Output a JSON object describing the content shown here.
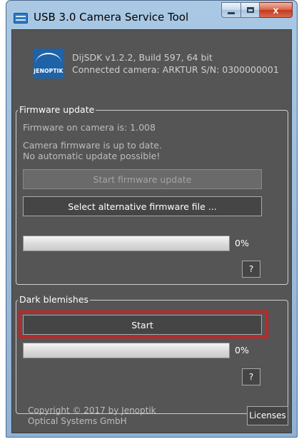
{
  "window": {
    "title": "USB 3.0 Camera Service Tool",
    "close_glyph": "x"
  },
  "logo": {
    "text": "JENOPTIK"
  },
  "sdk_info": {
    "version_line": "DijSDK v1.2.2, Build 597, 64 bit",
    "camera_line": "Connected camera: ARKTUR S/N: 0300000001"
  },
  "firmware_update": {
    "group_title": "Firmware update",
    "firmware_version": "Firmware on camera is: 1.008",
    "status_line1": "Camera firmware is up to date.",
    "status_line2": "No automatic update possible!",
    "start_button_label": "Start firmware update",
    "select_file_button_label": "Select alternative firmware file ...",
    "progress_label": "0%",
    "progress_value": 0,
    "help_button_label": "?"
  },
  "dark_blemishes": {
    "group_title": "Dark blemishes",
    "start_button_label": "Start",
    "progress_label": "0%",
    "progress_value": 0,
    "help_button_label": "?"
  },
  "footer": {
    "copyright_line1": "Copyright © 2017 by Jenoptik",
    "copyright_line2": "Optical Systems GmbH",
    "licenses_button_label": "Licenses"
  },
  "colors": {
    "panel_background": "#555555",
    "highlight_border": "#d11e1e",
    "logo_blue": "#1e62a8"
  },
  "icons": {
    "app": "camera-service-tool-icon",
    "minimize": "minimize-icon",
    "maximize": "maximize-icon",
    "close": "close-icon"
  }
}
